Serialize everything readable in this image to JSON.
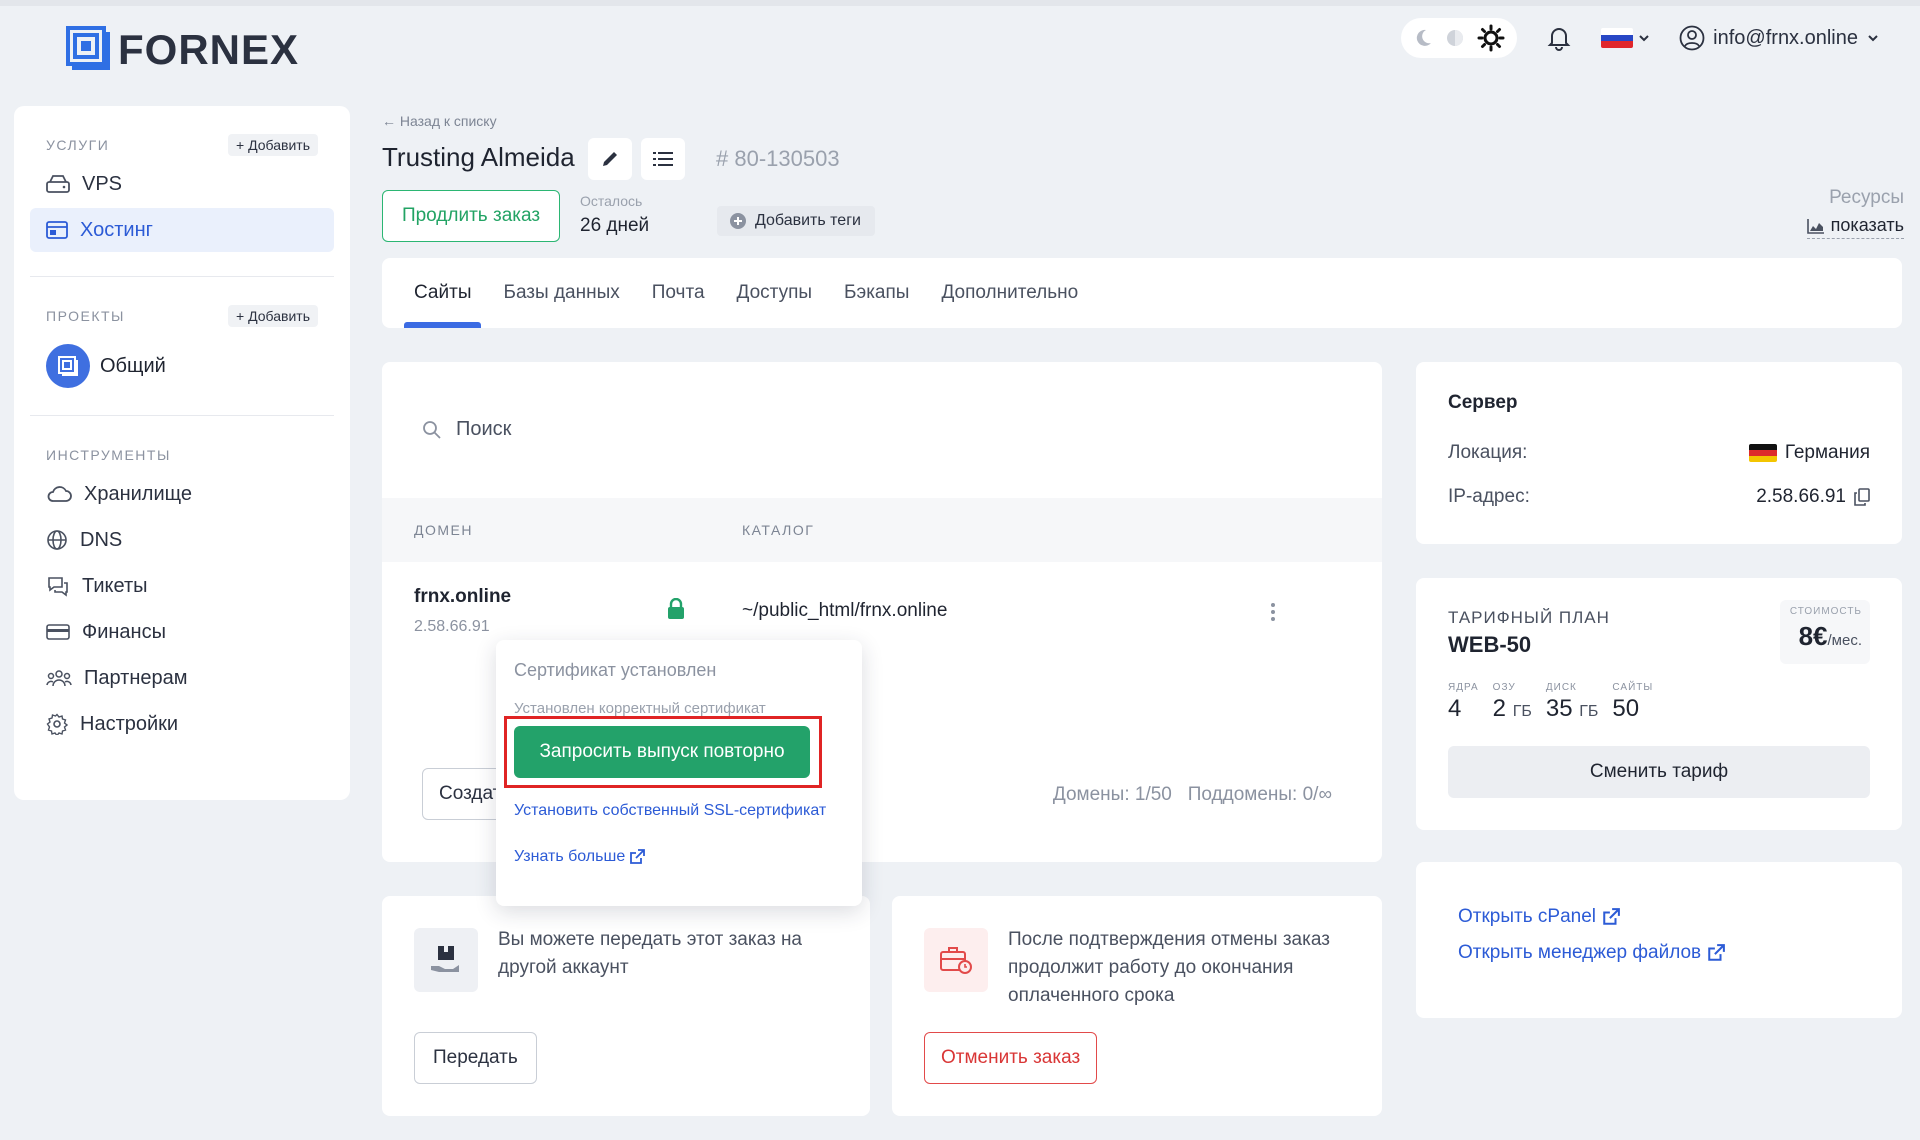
{
  "brand": {
    "name": "FORNEX"
  },
  "header": {
    "user_email": "info@frnx.online",
    "language": "ru"
  },
  "sidebar": {
    "services_title": "УСЛУГИ",
    "services_add": "Добавить",
    "services": [
      {
        "label": "VPS",
        "icon": "server-icon"
      },
      {
        "label": "Хостинг",
        "icon": "hosting-icon",
        "active": true
      }
    ],
    "projects_title": "ПРОЕКТЫ",
    "projects_add": "Добавить",
    "projects": [
      {
        "label": "Общий"
      }
    ],
    "tools_title": "ИНСТРУМЕНТЫ",
    "tools": [
      {
        "label": "Хранилище",
        "icon": "cloud-icon"
      },
      {
        "label": "DNS",
        "icon": "globe-icon"
      },
      {
        "label": "Тикеты",
        "icon": "chat-icon"
      },
      {
        "label": "Финансы",
        "icon": "card-icon"
      },
      {
        "label": "Партнерам",
        "icon": "users-icon"
      },
      {
        "label": "Настройки",
        "icon": "gear-icon"
      }
    ]
  },
  "order": {
    "back_label": "Назад к списку",
    "title": "Trusting Almeida",
    "number": "80-130503",
    "extend_label": "Продлить заказ",
    "remaining_label": "Осталось",
    "remaining_value": "26 дней",
    "add_tags_label": "Добавить теги",
    "resources_title": "Ресурсы",
    "resources_link": "показать"
  },
  "tabs": [
    {
      "label": "Сайты",
      "active": true
    },
    {
      "label": "Базы данных"
    },
    {
      "label": "Почта"
    },
    {
      "label": "Доступы"
    },
    {
      "label": "Бэкапы"
    },
    {
      "label": "Дополнительно"
    }
  ],
  "sites": {
    "search_placeholder": "Поиск",
    "col_domain": "ДОМЕН",
    "col_catalog": "КАТАЛОГ",
    "rows": [
      {
        "domain": "frnx.online",
        "ip": "2.58.66.91",
        "catalog": "~/public_html/frnx.online"
      }
    ],
    "create_label": "Создать сайт",
    "domains_count": "Домены: 1/50",
    "subdomains_count": "Поддомены: 0/∞"
  },
  "ssl_popover": {
    "title": "Сертификат установлен",
    "subtitle": "Установлен корректный сертификат",
    "reissue_button": "Запросить выпуск повторно",
    "custom_ssl_link": "Установить собственный SSL-сертификат",
    "learn_more_link": "Узнать больше"
  },
  "transfer_card": {
    "text": "Вы можете передать этот заказ на другой аккаунт",
    "button": "Передать"
  },
  "cancel_card": {
    "text": "После подтверждения отмены заказ продолжит работу до окончания оплаченного срока",
    "button": "Отменить заказ"
  },
  "server": {
    "title": "Сервер",
    "location_label": "Локация:",
    "location_value": "Германия",
    "ip_label": "IP-адрес:",
    "ip_value": "2.58.66.91"
  },
  "plan": {
    "label": "ТАРИФНЫЙ ПЛАН",
    "name": "WEB-50",
    "cost_label": "СТОИМОСТЬ",
    "cost_value": "8€",
    "cost_unit": "/мес.",
    "specs": [
      {
        "label": "ЯДРА",
        "value": "4",
        "unit": ""
      },
      {
        "label": "ОЗУ",
        "value": "2",
        "unit": "ГБ"
      },
      {
        "label": "ДИСК",
        "value": "35",
        "unit": "ГБ"
      },
      {
        "label": "САЙТЫ",
        "value": "50",
        "unit": ""
      }
    ],
    "change_button": "Сменить тариф"
  },
  "links": {
    "cpanel": "Открыть cPanel",
    "file_manager": "Открыть менеджер файлов"
  },
  "colors": {
    "accent": "#3b6be3",
    "success": "#23a26a",
    "danger": "#e02424",
    "link": "#2c5bd6"
  }
}
